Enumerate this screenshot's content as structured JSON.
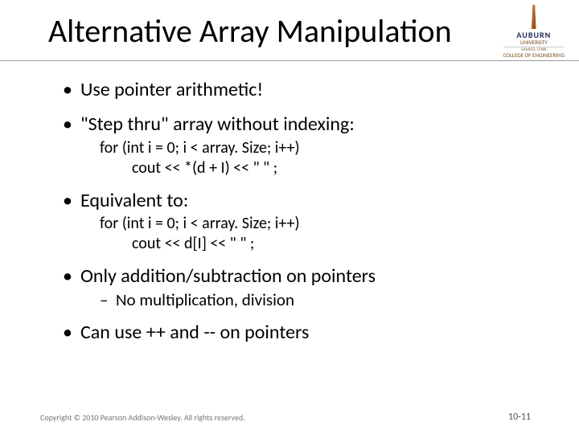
{
  "title": "Alternative Array Manipulation",
  "logo": {
    "name": "AUBURN",
    "subline1": "UNIVERSITY",
    "subline2": "SAMUEL GINN",
    "subline3": "COLLEGE OF ENGINEERING"
  },
  "bullets": {
    "b1": "Use pointer arithmetic!",
    "b2": "\"Step thru\" array  without indexing:",
    "code1_line1": "for (int i = 0; i < array. Size; i++)",
    "code1_line2": "cout << *(d + I) << \" \" ;",
    "b3": "Equivalent to:",
    "code2_line1": "for (int i = 0; i < array. Size; i++)",
    "code2_line2": "cout << d[I] << \" \" ;",
    "b4": "Only addition/subtraction on pointers",
    "b4_sub": "No multiplication, division",
    "b5": "Can use ++ and -- on pointers"
  },
  "footer": {
    "copyright": "Copyright © 2010 Pearson Addison-Wesley. All rights reserved.",
    "pagenum": "10-11"
  }
}
